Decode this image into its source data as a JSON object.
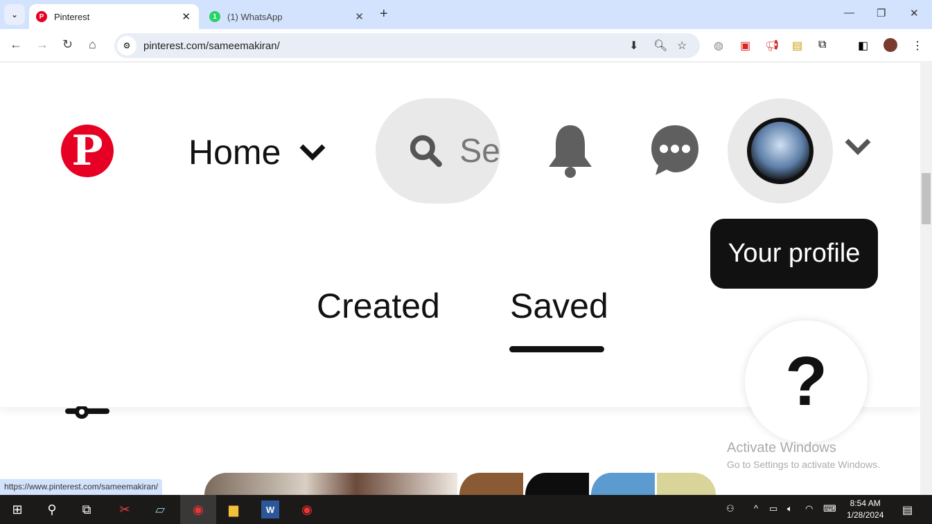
{
  "browser": {
    "tabs": [
      {
        "title": "Pinterest",
        "active": true,
        "icon": "pinterest-icon"
      },
      {
        "title": "(1) WhatsApp",
        "active": false,
        "icon": "whatsapp-icon",
        "badge": "1"
      }
    ],
    "url": "pinterest.com/sameemakiran/",
    "status_url": "https://www.pinterest.com/sameemakiran/"
  },
  "pinterest": {
    "logo": "P",
    "home_label": "Home",
    "search_placeholder": "Se",
    "tooltip": "Your profile",
    "tabs": [
      {
        "label": "Created",
        "active": false
      },
      {
        "label": "Saved",
        "active": true
      }
    ],
    "help_label": "?",
    "brand_color": "#e60023"
  },
  "watermark": {
    "title": "Activate Windows",
    "subtitle": "Go to Settings to activate Windows."
  },
  "taskbar": {
    "time": "8:54 AM",
    "date": "1/28/2024"
  }
}
